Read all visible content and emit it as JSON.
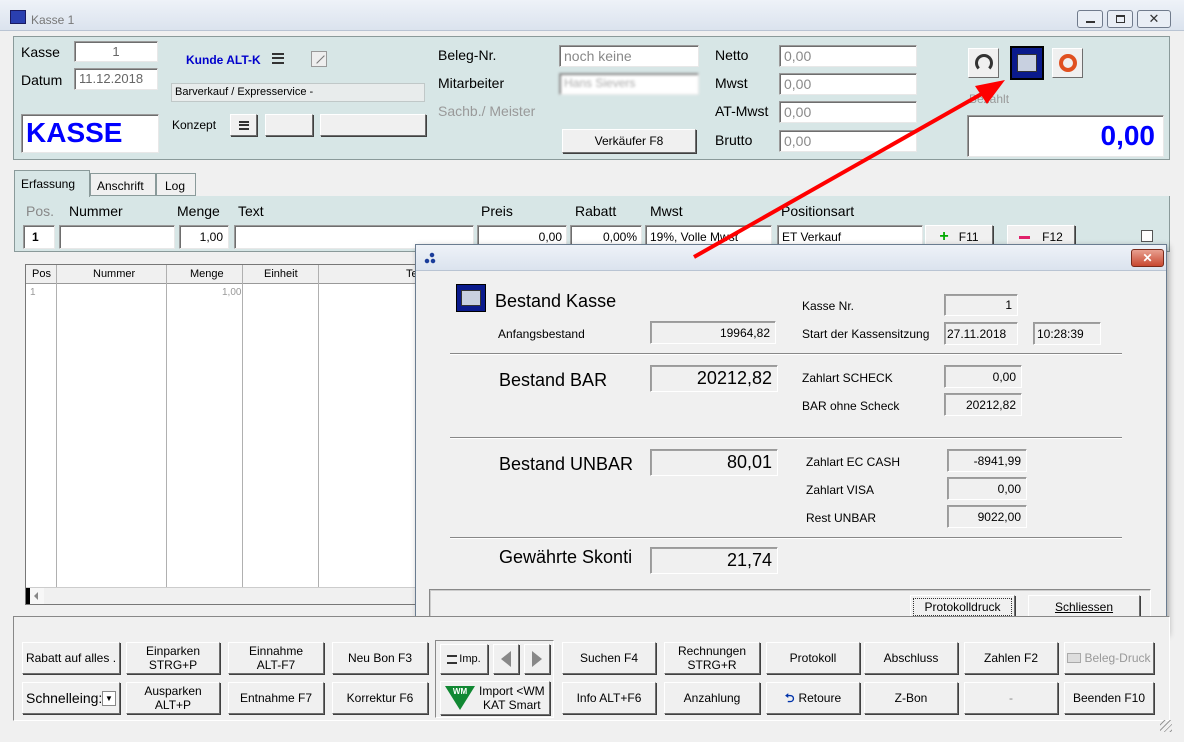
{
  "window": {
    "title": "Kasse 1"
  },
  "header": {
    "kasse_label": "Kasse",
    "kasse_value": "1",
    "datum_label": "Datum",
    "datum_value": "11.12.2018",
    "kasse_big": "KASSE",
    "kunde_label": "Kunde ALT-K",
    "kunde_text": "Barverkauf  /  Expresservice -",
    "konzept_label": "Konzept",
    "beleg_label": "Beleg-Nr.",
    "beleg_value": "noch keine",
    "mitarbeiter_label": "Mitarbeiter",
    "mitarbeiter_value": "Hans Sievers",
    "sachb_label": "Sachb./ Meister",
    "verkaeufer_button": "Verkäufer F8",
    "netto_label": "Netto",
    "netto_value": "0,00",
    "mwst_label": "Mwst",
    "mwst_value": "0,00",
    "atmwst_label": "AT-Mwst",
    "atmwst_value": "0,00",
    "brutto_label": "Brutto",
    "brutto_value": "0,00",
    "bezahlt_label": "Bezahlt",
    "total": "0,00"
  },
  "tabs": [
    {
      "label": "Erfassung"
    },
    {
      "label": "Anschrift"
    },
    {
      "label": "Log"
    }
  ],
  "entry": {
    "headers": {
      "pos": "Pos.",
      "nummer": "Nummer",
      "menge": "Menge",
      "text": "Text",
      "preis": "Preis",
      "rabatt": "Rabatt",
      "mwst": "Mwst",
      "positionsart": "Positionsart"
    },
    "pos": "1",
    "menge": "1,00",
    "preis": "0,00",
    "rabatt": "0,00%",
    "mwst": "19%, Volle Mwst",
    "positionsart": "ET Verkauf",
    "add_button": "F11",
    "remove_button": "F12"
  },
  "grid": {
    "headers": [
      "Pos",
      "Nummer",
      "Menge",
      "Einheit",
      "Te"
    ],
    "rows": [
      {
        "pos": "1",
        "menge": "1,00"
      }
    ]
  },
  "dialog": {
    "title": "Bestand Kasse",
    "kasse_nr_label": "Kasse Nr.",
    "kasse_nr": "1",
    "anfangsbestand_label": "Anfangsbestand",
    "anfangsbestand": "19964,82",
    "start_label": "Start der Kassensitzung",
    "start_date": "27.11.2018",
    "start_time": "10:28:39",
    "bar_label": "Bestand BAR",
    "bar_value": "20212,82",
    "scheck_label": "Zahlart SCHECK",
    "scheck_value": "0,00",
    "bar_ohne_label": "BAR ohne Scheck",
    "bar_ohne_value": "20212,82",
    "unbar_label": "Bestand UNBAR",
    "unbar_value": "80,01",
    "ec_label": "Zahlart EC CASH",
    "ec_value": "-8941,99",
    "visa_label": "Zahlart VISA",
    "visa_value": "0,00",
    "rest_label": "Rest UNBAR",
    "rest_value": "9022,00",
    "skonti_label": "Gewährte Skonti",
    "skonti_value": "21,74",
    "protokoll_button": "Protokolldruck",
    "schliessen_button": "Schliessen"
  },
  "toolbar": {
    "rabatt": "Rabatt auf alles .",
    "schnell": "Schnelleing:",
    "einparken": "Einparken\nSTRG+P",
    "ausparken": "Ausparken\nALT+P",
    "einnahme": "Einnahme\nALT-F7",
    "entnahme": "Entnahme F7",
    "neubon": "Neu Bon F3",
    "korrektur": "Korrektur F6",
    "imp": "Imp.",
    "import": "Import <WM\nKAT Smart",
    "suchen": "Suchen F4",
    "info": "Info ALT+F6",
    "rechnungen": "Rechnungen\nSTRG+R",
    "anzahlung": "Anzahlung",
    "protokoll": "Protokoll",
    "retoure": "Retoure",
    "abschluss": "Abschluss",
    "zbon": "Z-Bon",
    "zahlen": "Zahlen F2",
    "dash": "-",
    "belegdruck": "Beleg-Druck",
    "beenden": "Beenden F10",
    "wm_logo": "WM"
  },
  "colors": {
    "accent": "#0000ff",
    "panel": "#d7e6e6",
    "arrow": "#ff0000"
  }
}
